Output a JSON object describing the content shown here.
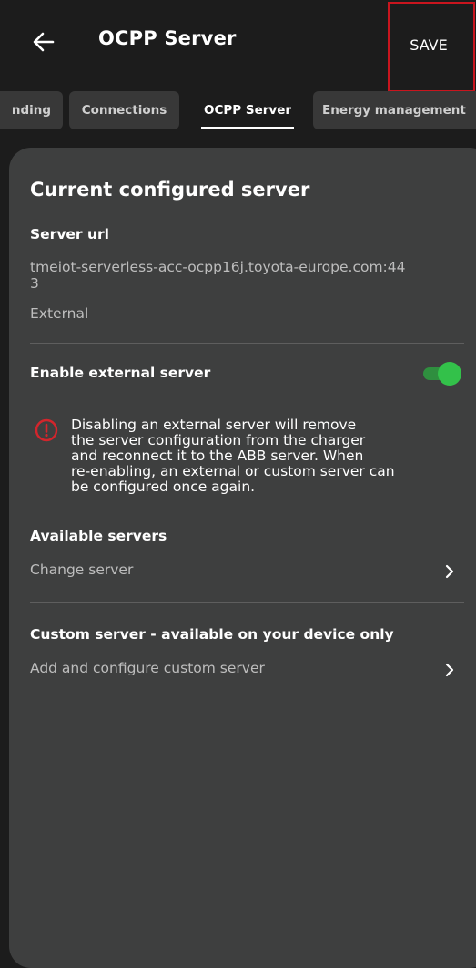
{
  "header": {
    "title": "OCPP Server",
    "save_label": "SAVE",
    "back_icon": "arrow-left-icon"
  },
  "tabs": [
    {
      "label": "nding"
    },
    {
      "label": "Connections"
    },
    {
      "label": "OCPP Server",
      "active": true
    },
    {
      "label": "Energy management"
    }
  ],
  "current_server": {
    "heading": "Current configured server",
    "url_label": "Server url",
    "url_line1": "tmeiot-serverless-acc-ocpp16j.toyota-europe.com:44",
    "url_line2": "3",
    "type": "External"
  },
  "external": {
    "label": "Enable external server",
    "enabled": true,
    "accent_color": "#33c14a",
    "warning_icon": "alert-circle-icon",
    "warning_color": "#d3252c",
    "warning_lines": [
      "Disabling an external server will remove",
      "the server configuration from the charger",
      "and reconnect it to the ABB server. When",
      "re-enabling, an external or custom server can",
      "be configured once again."
    ]
  },
  "available": {
    "heading": "Available servers",
    "change_label": "Change server"
  },
  "custom": {
    "heading": "Custom server - available on your device only",
    "add_label": "Add and configure custom server"
  }
}
